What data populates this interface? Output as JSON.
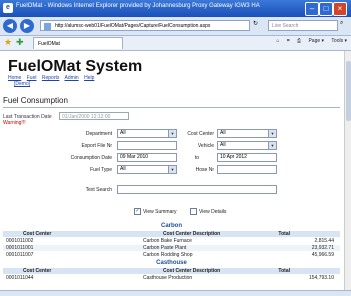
{
  "window": {
    "title": "FuelOMat - Windows Internet Explorer provided by Johannesburg Proxy Gateway IGW3 HA",
    "url": "http://alumsc-web01/FuelOMat/Pages/Capture/FuelConsumption.aspx",
    "search_placeholder": "Live Search",
    "tab_label": "FuelOMat",
    "tools": [
      "Page ▾",
      "Tools ▾"
    ]
  },
  "app": {
    "title": "FuelOMat System",
    "menu": [
      "Home",
      "Fuel",
      "Reports",
      "Admin",
      "Help"
    ],
    "demo_link": "[Demo]"
  },
  "page": {
    "heading": "Fuel Consumption",
    "last_transaction_label": "Last Transaction Date",
    "last_transaction_value": "01/Jan/2000 12:12:00",
    "warning": "Warning!!!"
  },
  "filters": {
    "department_label": "Department",
    "department_value": "All",
    "cost_center_label": "Cost Center",
    "cost_center_value": "All",
    "export_file_label": "Export File Nr",
    "export_file_value": "",
    "vehicle_label": "Vehicle",
    "vehicle_value": "All",
    "consumption_date_label": "Consumption Date",
    "date_from": "09 Mar 2010",
    "to_label": "to",
    "date_to": "10 Apr 2012",
    "fuel_type_label": "Fuel Type",
    "fuel_type_value": "All",
    "hose_label": "Hose Nr",
    "hose_value": "",
    "text_search_label": "Text Search",
    "text_search_value": ""
  },
  "view": {
    "summary_label": "View Summary",
    "summary_checked": true,
    "details_label": "View Details",
    "details_checked": false
  },
  "grid": {
    "columns": [
      "Cost Center",
      "Cost Center Description",
      "Total"
    ],
    "groups": [
      {
        "name": "Carbon",
        "rows": [
          [
            "0001011002",
            "Carbon Bake Furnace",
            "2,815.44"
          ],
          [
            "0001011001",
            "Carbon Paste Plant",
            "23,932.71"
          ],
          [
            "0001011007",
            "Carbon Rodding Shop",
            "45,966.59"
          ]
        ]
      },
      {
        "name": "Casthouse",
        "rows": [
          [
            "0001011044",
            "Casthouse Production",
            "154,793.10"
          ]
        ]
      }
    ]
  },
  "colors": {
    "titlebar": "#1a4fb8",
    "link": "#2244aa",
    "warning": "#cc0000",
    "group": "#1a4f9c"
  }
}
